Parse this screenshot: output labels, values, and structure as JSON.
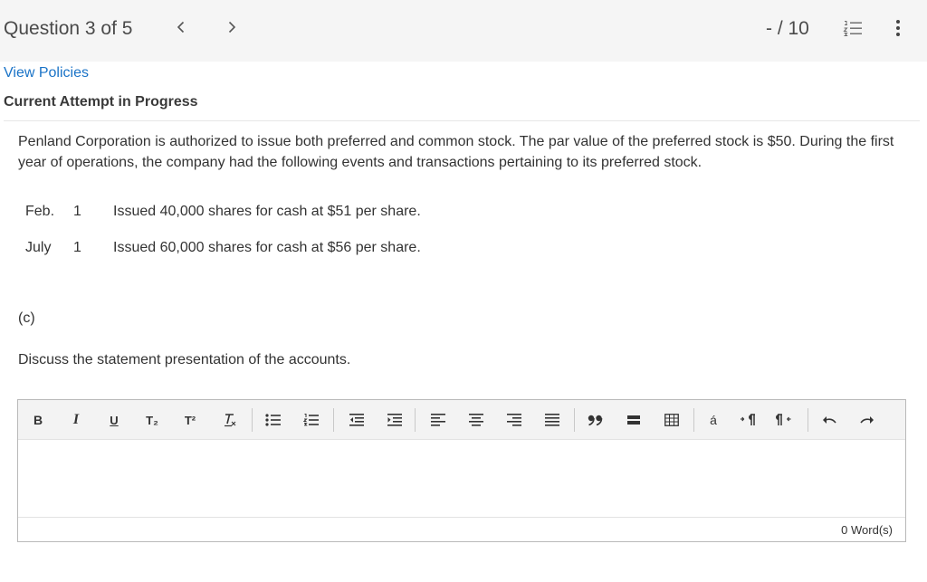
{
  "header": {
    "question_label": "Question 3 of 5",
    "score": "- / 10",
    "icons": [
      "chevron-left-icon",
      "chevron-right-icon",
      "numbered-list-icon",
      "more-vertical-icon"
    ]
  },
  "policies_link": "View Policies",
  "attempt_label": "Current Attempt in Progress",
  "prompt": "Penland Corporation is authorized to issue both preferred and common stock. The par value of the preferred stock is $50. During the first year of operations, the company had the following events and transactions pertaining to its preferred stock.",
  "transactions": [
    {
      "month": "Feb.",
      "day": "1",
      "description": "Issued 40,000 shares for cash at $51 per share."
    },
    {
      "month": "July",
      "day": "1",
      "description": "Issued 60,000 shares for cash at $56 per share."
    }
  ],
  "part_label": "(c)",
  "instruction": "Discuss the statement presentation of the accounts.",
  "editor": {
    "bold_glyph": "B",
    "italic_glyph": "I",
    "underline_glyph": "U",
    "subscript_glyph": "T₂",
    "superscript_glyph": "T²",
    "accent_glyph": "á",
    "word_count": "0 Word(s)",
    "colors": {
      "toolbar_bg": "#f3f3f3",
      "border": "#b9b9b9",
      "link": "#1a73c7"
    }
  }
}
